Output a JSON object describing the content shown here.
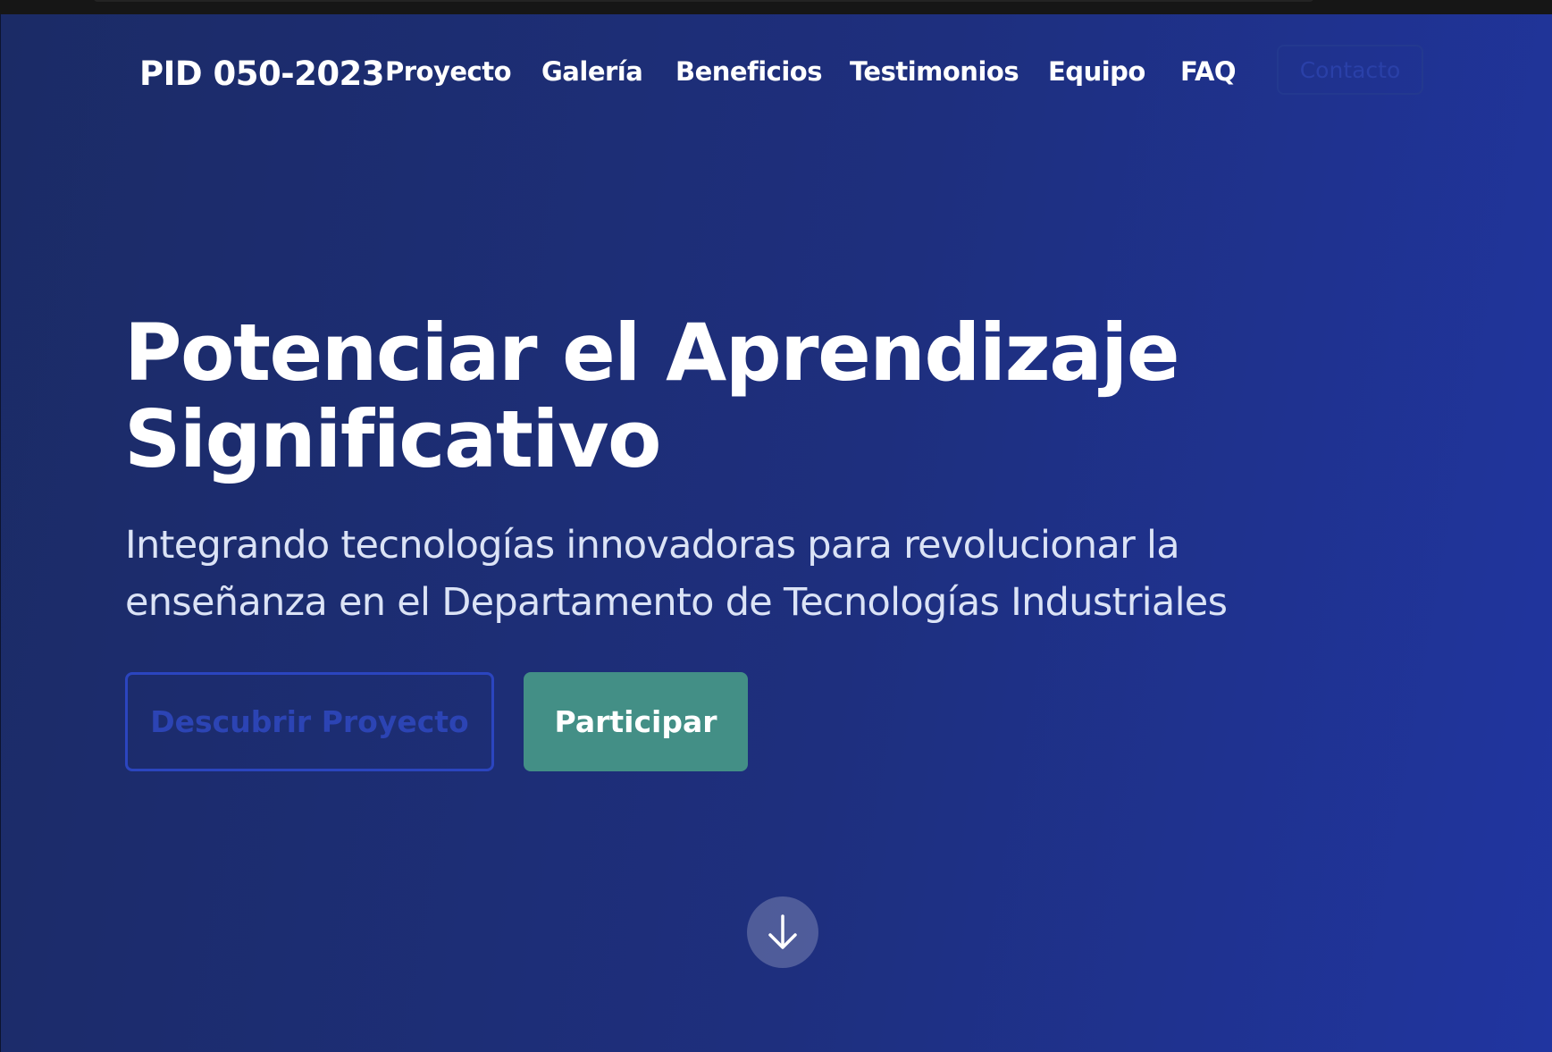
{
  "brand": "PID 050-2023",
  "nav": {
    "items": [
      "Proyecto",
      "Galería",
      "Beneficios",
      "Testimonios",
      "Equipo",
      "FAQ"
    ],
    "contact_label": "Contacto"
  },
  "hero": {
    "title_line1": "Potenciar el Aprendizaje",
    "title_line2": "Significativo",
    "subtitle_line1": "Integrando tecnologías innovadoras para revolucionar la",
    "subtitle_line2": "enseñanza en el Departamento de Tecnologías Industriales",
    "discover_label": "Descubrir Proyecto",
    "participate_label": "Participar"
  },
  "icons": {
    "scroll_down": "arrow-down-icon"
  },
  "colors": {
    "background_start": "#1b2b66",
    "background_end": "#2035a0",
    "accent_green": "#438f86",
    "outline_blue": "#2b45bf"
  }
}
